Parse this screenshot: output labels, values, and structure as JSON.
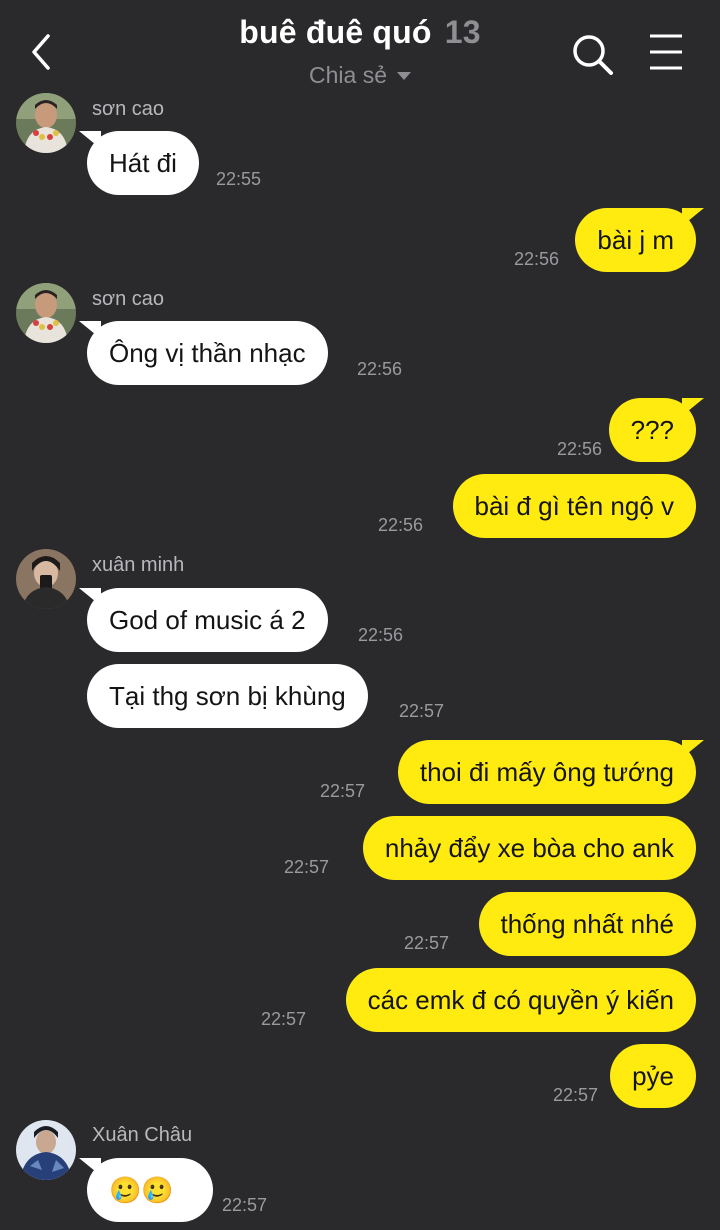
{
  "header": {
    "title": "buê đuê quó",
    "member_count": "13",
    "subtitle": "Chia sẻ",
    "icons": {
      "back": "chevron-left-icon",
      "search": "search-icon",
      "menu": "hamburger-menu-icon"
    }
  },
  "messages": [
    {
      "sender": "sơn cao",
      "text": "Hát đi",
      "time": "22:55"
    },
    {
      "text": "bài j m",
      "time": "22:56"
    },
    {
      "sender": "sơn cao",
      "text": "Ông vị thần nhạc",
      "time": "22:56"
    },
    {
      "text": "???",
      "time": "22:56"
    },
    {
      "text": "bài đ gì tên ngộ v",
      "time": "22:56"
    },
    {
      "sender": "xuân minh",
      "text": "God of music á 2",
      "time": "22:56"
    },
    {
      "text": "Tại thg sơn bị khùng",
      "time": "22:57"
    },
    {
      "text": "thoi đi mấy ông tướng",
      "time": "22:57"
    },
    {
      "text": "nhảy đẩy xe bòa cho ank",
      "time": "22:57"
    },
    {
      "text": "thống nhất nhé",
      "time": "22:57"
    },
    {
      "text": "các emk đ có quyền ý kiến",
      "time": "22:57"
    },
    {
      "text": "pỷe",
      "time": "22:57"
    },
    {
      "sender": "Xuân Châu",
      "text": "🥲🥲",
      "time": "22:57"
    }
  ],
  "colors": {
    "background": "#2a2a2c",
    "incoming_bubble": "#ffffff",
    "outgoing_bubble": "#ffeb10",
    "timestamp": "#9a9a9e"
  }
}
